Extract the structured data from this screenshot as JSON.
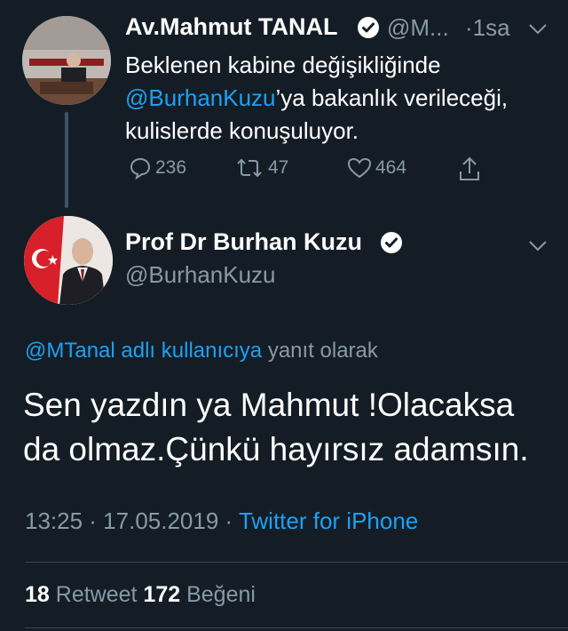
{
  "tweet1": {
    "author_name": "Av.Mahmut TANAL",
    "handle_truncated": "@M...",
    "time": "·1sa",
    "text_before": "Beklenen kabine değişikliğinde",
    "mention": "@BurhanKuzu",
    "text_after": "’ya bakanlık verileceği, kulislerde konuşuluyor.",
    "replies": "236",
    "retweets": "47",
    "likes": "464"
  },
  "tweet2": {
    "author_name": "Prof Dr Burhan Kuzu",
    "handle": "@BurhanKuzu",
    "reply_link": "@MTanal adlı kullanıcıya",
    "reply_suffix": " yanıt olarak",
    "text": "Sen yazdın ya Mahmut !Olacaksa da olmaz.Çünkü hayırsız adamsın.",
    "time": "13:25 · 17.05.2019 · ",
    "source": "Twitter for iPhone",
    "retweet_count": "18",
    "retweet_label": " Retweet ",
    "like_count": "172",
    "like_label": " Beğeni"
  },
  "icons": [
    "verified-icon",
    "chevron-down-icon",
    "reply-icon",
    "retweet-icon",
    "like-icon",
    "share-icon"
  ],
  "colors": {
    "background": "#141d26",
    "link": "#1da1f2",
    "muted": "#8899a6",
    "divider": "#38444d"
  }
}
